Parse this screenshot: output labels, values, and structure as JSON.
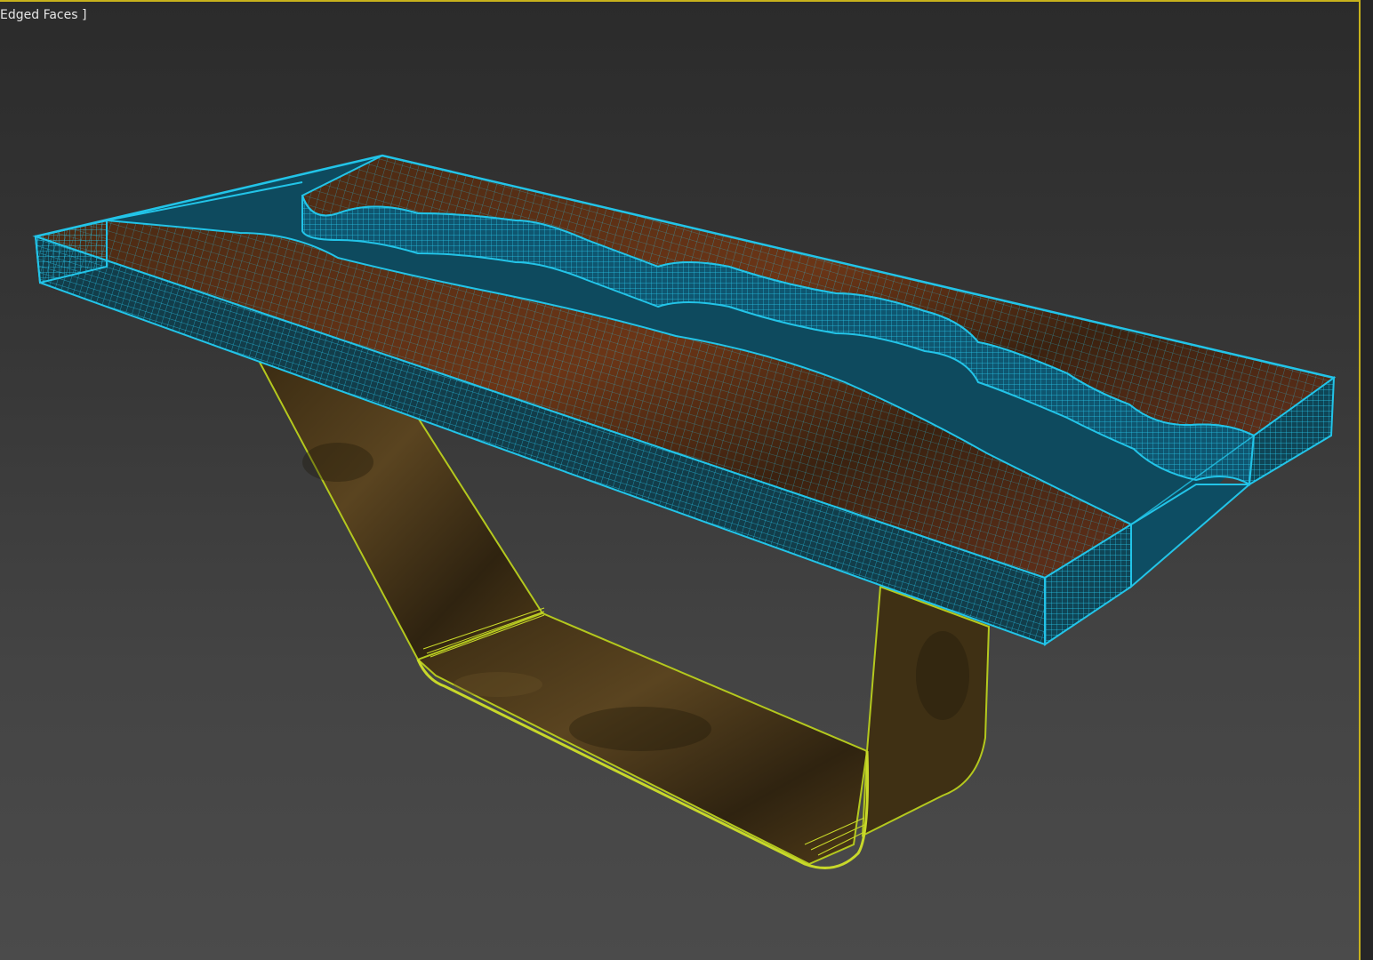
{
  "viewport": {
    "label": "Edged Faces ]",
    "active_border_color": "#c8b21c"
  },
  "scene": {
    "object": "river-table",
    "top_wireframe_color": "#22c4e8",
    "leg_wireframe_color": "#b4c81e",
    "resin_color": "#0e4a5e",
    "wood_color": "#5a2e12",
    "leg_color": "#4a3616"
  }
}
